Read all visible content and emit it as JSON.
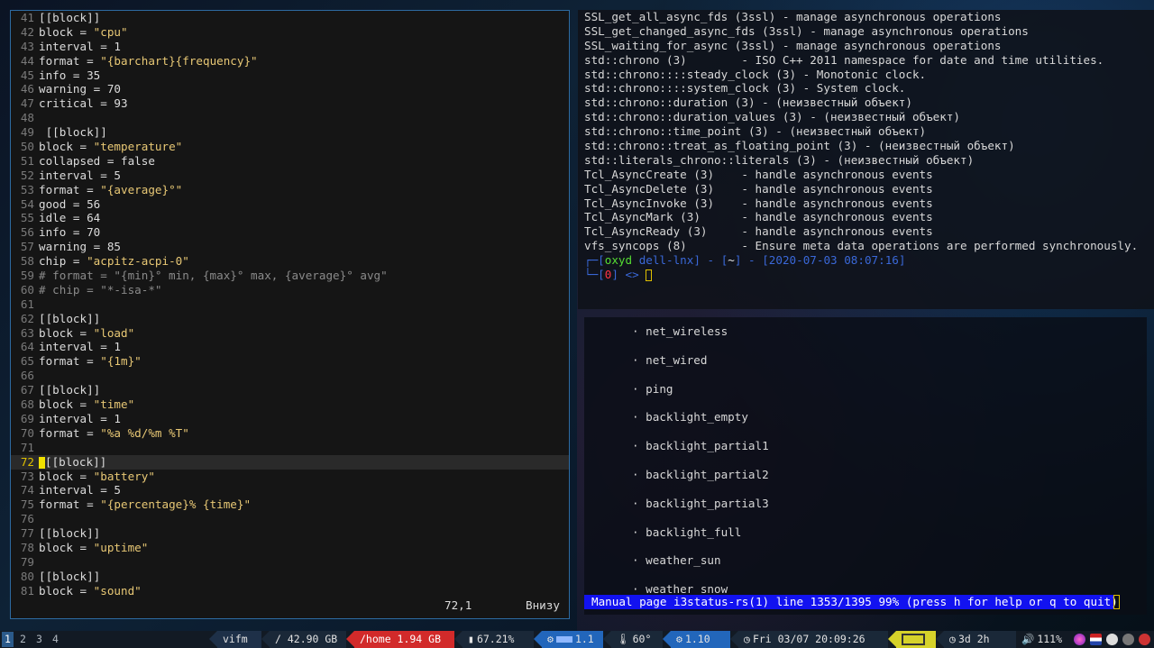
{
  "editor": {
    "lines": [
      {
        "n": "41",
        "text": "[[block]]"
      },
      {
        "n": "42",
        "text": "block = ",
        "str": "\"cpu\""
      },
      {
        "n": "43",
        "text": "interval = 1"
      },
      {
        "n": "44",
        "text": "format = ",
        "str": "\"{barchart}{frequency}\""
      },
      {
        "n": "45",
        "text": "info = 35"
      },
      {
        "n": "46",
        "text": "warning = 70"
      },
      {
        "n": "47",
        "text": "critical = 93"
      },
      {
        "n": "48",
        "text": ""
      },
      {
        "n": "49",
        "text": " [[block]]"
      },
      {
        "n": "50",
        "text": "block = ",
        "str": "\"temperature\""
      },
      {
        "n": "51",
        "text": "collapsed = false"
      },
      {
        "n": "52",
        "text": "interval = 5"
      },
      {
        "n": "53",
        "text": "format = ",
        "str": "\"{average}°\""
      },
      {
        "n": "54",
        "text": "good = 56"
      },
      {
        "n": "55",
        "text": "idle = 64"
      },
      {
        "n": "56",
        "text": "info = 70"
      },
      {
        "n": "57",
        "text": "warning = 85"
      },
      {
        "n": "58",
        "text": "chip = ",
        "str": "\"acpitz-acpi-0\""
      },
      {
        "n": "59",
        "cmt": "# format = \"{min}° min, {max}° max, {average}° avg\""
      },
      {
        "n": "60",
        "cmt": "# chip = \"*-isa-*\""
      },
      {
        "n": "61",
        "text": ""
      },
      {
        "n": "62",
        "text": "[[block]]"
      },
      {
        "n": "63",
        "text": "block = ",
        "str": "\"load\""
      },
      {
        "n": "64",
        "text": "interval = 1"
      },
      {
        "n": "65",
        "text": "format = ",
        "str": "\"{1m}\""
      },
      {
        "n": "66",
        "text": ""
      },
      {
        "n": "67",
        "text": "[[block]]"
      },
      {
        "n": "68",
        "text": "block = ",
        "str": "\"time\""
      },
      {
        "n": "69",
        "text": "interval = 1"
      },
      {
        "n": "70",
        "text": "format = ",
        "str": "\"%a %d/%m %T\""
      },
      {
        "n": "71",
        "text": ""
      },
      {
        "n": "72",
        "text": "[[block]]",
        "current": true
      },
      {
        "n": "73",
        "text": "block = ",
        "str": "\"battery\""
      },
      {
        "n": "74",
        "text": "interval = 5"
      },
      {
        "n": "75",
        "text": "format = ",
        "str": "\"{percentage}% {time}\""
      },
      {
        "n": "76",
        "text": ""
      },
      {
        "n": "77",
        "text": "[[block]]"
      },
      {
        "n": "78",
        "text": "block = ",
        "str": "\"uptime\""
      },
      {
        "n": "79",
        "text": ""
      },
      {
        "n": "80",
        "text": "[[block]]"
      },
      {
        "n": "81",
        "text": "block = ",
        "str": "\"sound\""
      }
    ],
    "cursor_pos": "72,1",
    "scroll_pos": "Внизу"
  },
  "terminal": {
    "lines": [
      "SSL_get_all_async_fds (3ssl) - manage asynchronous operations",
      "SSL_get_changed_async_fds (3ssl) - manage asynchronous operations",
      "SSL_waiting_for_async (3ssl) - manage asynchronous operations",
      "std::chrono (3)        - ISO C++ 2011 namespace for date and time utilities.",
      "std::chrono::::steady_clock (3) - Monotonic clock.",
      "std::chrono::::system_clock (3) - System clock.",
      "std::chrono::duration (3) - (неизвестный объект)",
      "std::chrono::duration_values (3) - (неизвестный объект)",
      "std::chrono::time_point (3) - (неизвестный объект)",
      "std::chrono::treat_as_floating_point (3) - (неизвестный объект)",
      "std::literals_chrono::literals (3) - (неизвестный объект)",
      "Tcl_AsyncCreate (3)    - handle asynchronous events",
      "Tcl_AsyncDelete (3)    - handle asynchronous events",
      "Tcl_AsyncInvoke (3)    - handle asynchronous events",
      "Tcl_AsyncMark (3)      - handle asynchronous events",
      "Tcl_AsyncReady (3)     - handle asynchronous events",
      "vfs_syncops (8)        - Ensure meta data operations are performed synchronously."
    ],
    "prompt": {
      "user": "oxyd",
      "host": "dell-lnx",
      "dir": "~",
      "datetime": "2020-07-03 08:07:16",
      "status": "0",
      "arrow": "<>"
    }
  },
  "manpage": {
    "items": [
      "net_wireless",
      "net_wired",
      "ping",
      "backlight_empty",
      "backlight_partial1",
      "backlight_partial2",
      "backlight_partial3",
      "backlight_full",
      "weather_sun",
      "weather_snow"
    ],
    "status": "Manual page i3status-rs(1) line 1353/1395 99% (press h for help or q to quit)"
  },
  "bar": {
    "workspaces": [
      "1",
      "2",
      "3",
      "4"
    ],
    "vifm": "vifm",
    "disk_root": "/ 42.90 GB",
    "disk_home": "/home 1.94 GB",
    "memory": "67.21%",
    "cpu": "1.1",
    "temperature": "60°",
    "load": "1.10",
    "time": "Fri 03/07 20:09:26",
    "uptime": "3d 2h",
    "volume": "111%",
    "colors": {
      "red": "#d22a2a",
      "blue": "#2266bb",
      "yellow": "#d6d22a",
      "dark": "#1e3048"
    }
  }
}
